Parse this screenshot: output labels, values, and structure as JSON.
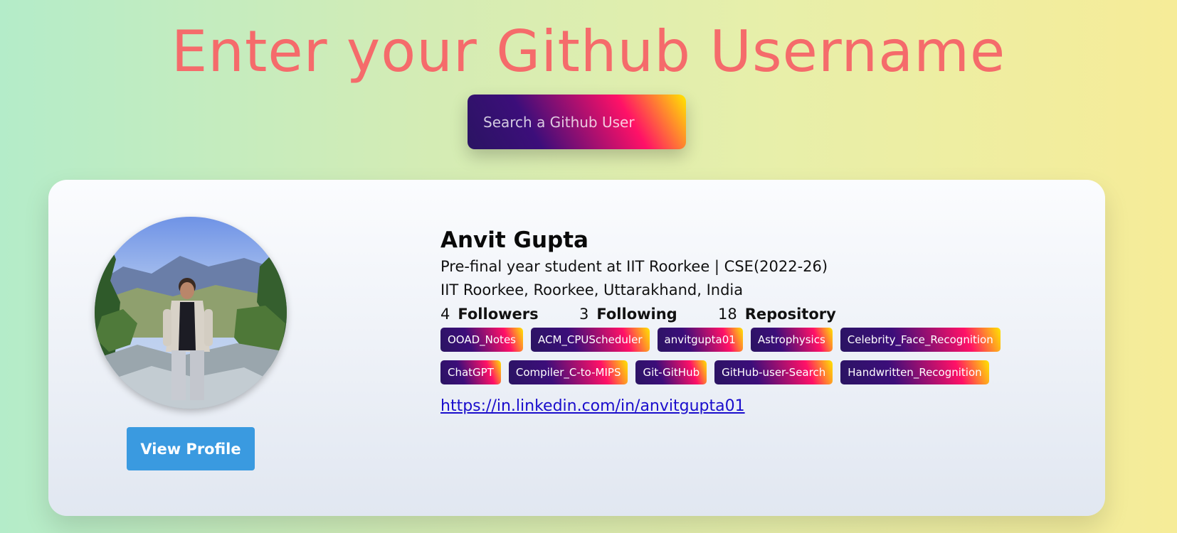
{
  "header": {
    "title": "Enter your Github Username"
  },
  "search": {
    "placeholder": "Search a Github User",
    "value": ""
  },
  "profile": {
    "name": "Anvit Gupta",
    "bio": "Pre-final year student at IIT Roorkee | CSE(2022-26)",
    "location": "IIT Roorkee, Roorkee, Uttarakhand, India",
    "stats": {
      "followers_count": "4",
      "followers_label": "Followers",
      "following_count": "3",
      "following_label": "Following",
      "repos_count": "18",
      "repos_label": "Repository"
    },
    "repos": [
      "OOAD_Notes",
      "ACM_CPUScheduler",
      "anvitgupta01",
      "Astrophysics",
      "Celebrity_Face_Recognition",
      "ChatGPT",
      "Compiler_C-to-MIPS",
      "Git-GitHub",
      "GitHub-user-Search",
      "Handwritten_Recognition"
    ],
    "link": "https://in.linkedin.com/in/anvitgupta01",
    "view_button_label": "View Profile",
    "avatar_icon": "user-avatar-photo"
  },
  "colors": {
    "title": "#f56b6b",
    "button": "#3a9ae0",
    "link": "#1a0dcc",
    "gradient_start": "#2a1462",
    "gradient_mid": "#ff1167",
    "gradient_end": "#ffe600"
  }
}
